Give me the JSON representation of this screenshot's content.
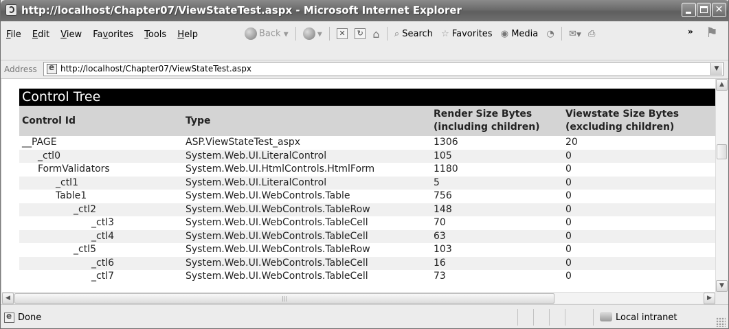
{
  "window": {
    "title": "http://localhost/Chapter07/ViewStateTest.aspx - Microsoft Internet Explorer"
  },
  "menu": {
    "items": [
      {
        "first": "F",
        "rest": "ile"
      },
      {
        "first": "E",
        "rest": "dit"
      },
      {
        "first": "V",
        "rest": "iew"
      },
      {
        "first": "Fa",
        "u": "v",
        "rest": "orites"
      },
      {
        "first": "T",
        "rest": "ools"
      },
      {
        "first": "H",
        "rest": "elp"
      }
    ]
  },
  "toolbar": {
    "back_label": "Back",
    "search_label": "Search",
    "favorites_label": "Favorites",
    "media_label": "Media",
    "overflow_label": "»"
  },
  "address": {
    "label": "Address",
    "url": "http://localhost/Chapter07/ViewStateTest.aspx"
  },
  "trace": {
    "section_title": "Control Tree",
    "columns": {
      "id": "Control Id",
      "type": "Type",
      "render_1": "Render Size Bytes",
      "render_2": "(including children)",
      "viewstate_1": "Viewstate Size Bytes",
      "viewstate_2": "(excluding children)"
    },
    "rows": [
      {
        "id": "__PAGE",
        "type": "ASP.ViewStateTest_aspx",
        "render": "1306",
        "viewstate": "20"
      },
      {
        "id": "_ctl0",
        "type": "System.Web.UI.LiteralControl",
        "render": "105",
        "viewstate": "0"
      },
      {
        "id": "FormValidators",
        "type": "System.Web.UI.HtmlControls.HtmlForm",
        "render": "1180",
        "viewstate": "0"
      },
      {
        "id": "_ctl1",
        "type": "System.Web.UI.LiteralControl",
        "render": "5",
        "viewstate": "0"
      },
      {
        "id": "Table1",
        "type": "System.Web.UI.WebControls.Table",
        "render": "756",
        "viewstate": "0"
      },
      {
        "id": "_ctl2",
        "type": "System.Web.UI.WebControls.TableRow",
        "render": "148",
        "viewstate": "0"
      },
      {
        "id": "_ctl3",
        "type": "System.Web.UI.WebControls.TableCell",
        "render": "70",
        "viewstate": "0"
      },
      {
        "id": "_ctl4",
        "type": "System.Web.UI.WebControls.TableCell",
        "render": "63",
        "viewstate": "0"
      },
      {
        "id": "_ctl5",
        "type": "System.Web.UI.WebControls.TableRow",
        "render": "103",
        "viewstate": "0"
      },
      {
        "id": "_ctl6",
        "type": "System.Web.UI.WebControls.TableCell",
        "render": "16",
        "viewstate": "0"
      },
      {
        "id": "_ctl7",
        "type": "System.Web.UI.WebControls.TableCell",
        "render": "73",
        "viewstate": "0"
      }
    ]
  },
  "status": {
    "text": "Done",
    "zone": "Local intranet"
  }
}
